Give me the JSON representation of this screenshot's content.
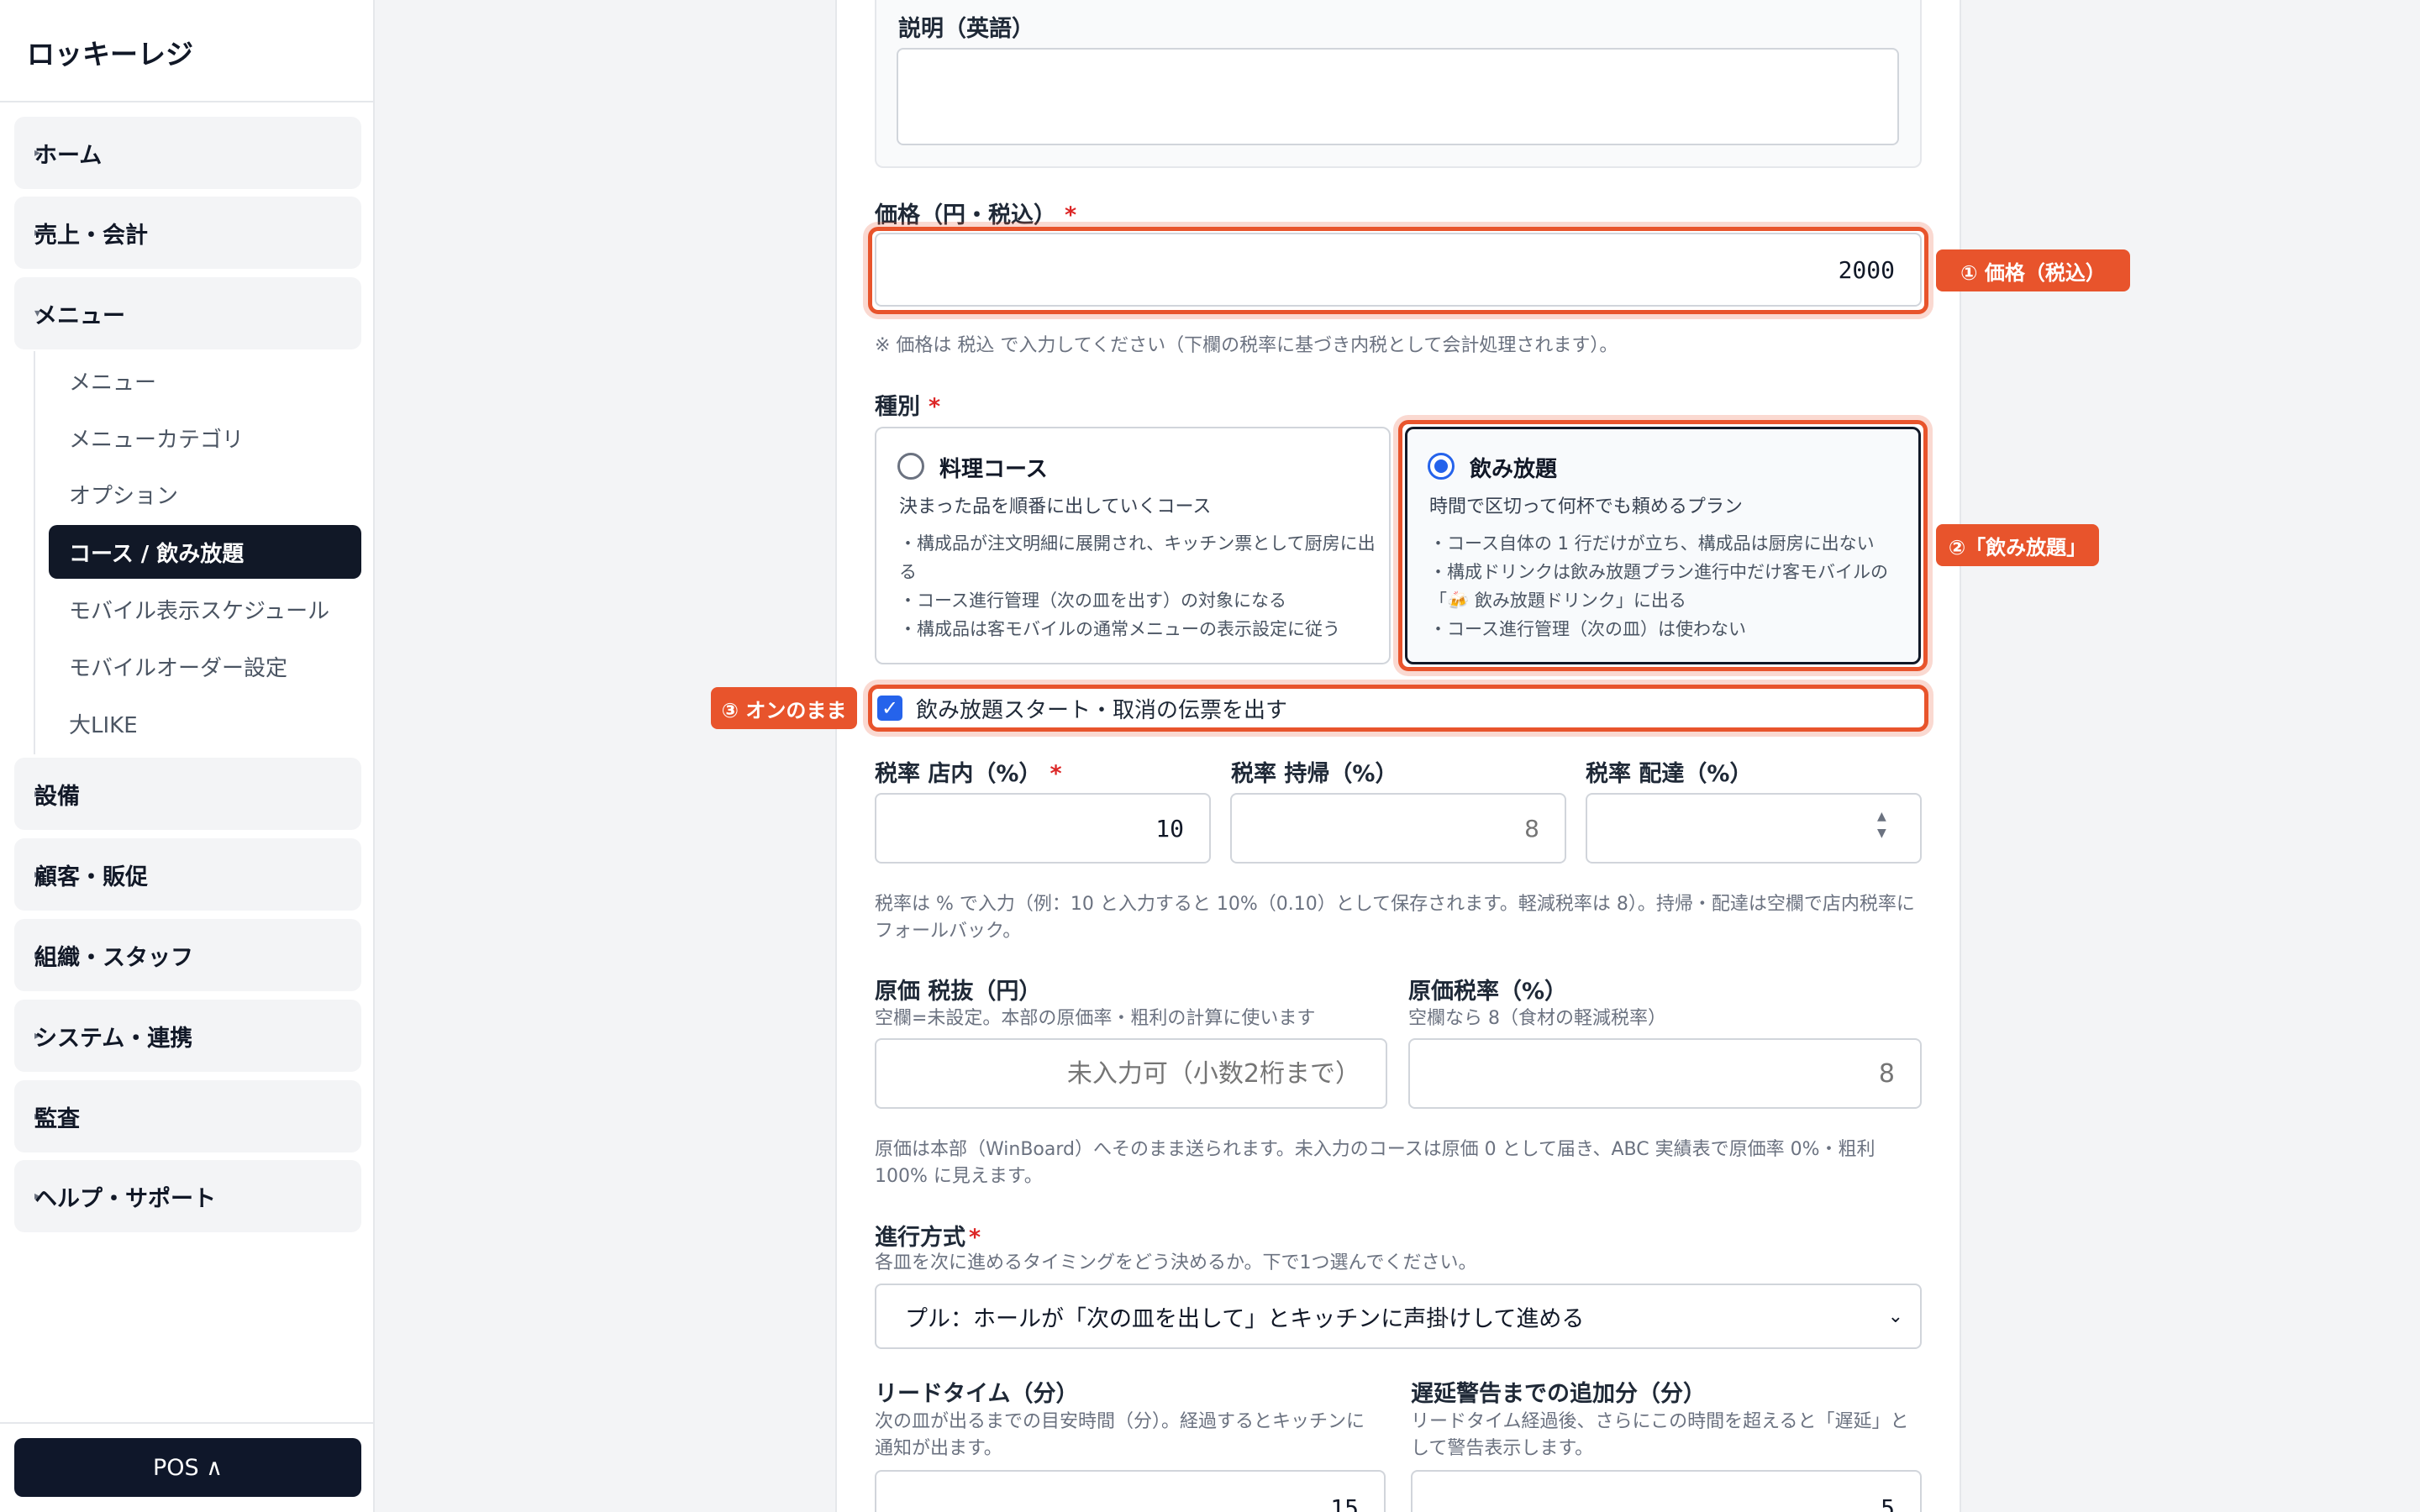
{
  "sidebar": {
    "brand": "ロッキーレジ",
    "groups": [
      {
        "label": "ホーム",
        "arrow": "▸"
      },
      {
        "label": "売上・会計",
        "arrow": "▸"
      },
      {
        "label": "メニュー",
        "arrow": "▾"
      },
      {
        "label": "設備",
        "arrow": "▸"
      },
      {
        "label": "顧客・販促",
        "arrow": "▸"
      },
      {
        "label": "組織・スタッフ",
        "arrow": "▸"
      },
      {
        "label": "システム・連携",
        "arrow": "▸"
      },
      {
        "label": "監査",
        "arrow": "▸"
      },
      {
        "label": "ヘルプ・サポート",
        "arrow": "▸"
      }
    ],
    "menu_items": [
      "メニュー",
      "メニューカテゴリ",
      "オプション",
      "コース / 飲み放題",
      "モバイル表示スケジュール",
      "モバイルオーダー設定",
      "大LIKE"
    ],
    "active_item": "コース / 飲み放題",
    "pos_button": "POS ∧"
  },
  "form": {
    "desc_en_label": "説明（英語）",
    "price_label": "価格（円・税込）",
    "required_mark": "*",
    "price_value": "2000",
    "price_note": "※ 価格は 税込 で入力してください（下欄の税率に基づき内税として会計処理されます）。",
    "type_label": "種別",
    "type_cooking": {
      "title": "料理コース",
      "desc": "決まった品を順番に出していくコース",
      "bullets": [
        "・構成品が注文明細に展開され、キッチン票として厨房に出る",
        "・コース進行管理（次の皿を出す）の対象になる",
        "・構成品は客モバイルの通常メニューの表示設定に従う"
      ]
    },
    "type_drink": {
      "title": "飲み放題",
      "desc": "時間で区切って何杯でも頼めるプラン",
      "bullets": [
        "・コース自体の 1 行だけが立ち、構成品は厨房に出ない",
        "・構成ドリンクは飲み放題プラン進行中だけ客モバイルの「🍻 飲み放題ドリンク」に出る",
        "・コース進行管理（次の皿）は使わない"
      ]
    },
    "slip_checkbox_label": "飲み放題スタート・取消の伝票を出す",
    "tax_in_label": "税率 店内（%）",
    "tax_in_value": "10",
    "tax_takeout_label": "税率 持帰（%）",
    "tax_takeout_placeholder": "8",
    "tax_delivery_label": "税率 配達（%）",
    "tax_help": "税率は % で入力（例：10 と入力すると 10%（0.10）として保存されます。軽減税率は 8）。持帰・配達は空欄で店内税率にフォールバック。",
    "cost_label": "原価 税抜（円）",
    "cost_help": "空欄=未設定。本部の原価率・粗利の計算に使います",
    "cost_placeholder": "未入力可（小数2桁まで）",
    "cost_tax_label": "原価税率（%）",
    "cost_tax_help": "空欄なら 8（食材の軽減税率）",
    "cost_tax_placeholder": "8",
    "cost_note": "原価は本部（WinBoard）へそのまま送られます。未入力のコースは原価 0 として届き、ABC 実績表で原価率 0%・粗利 100% に見えます。",
    "progress_label": "進行方式",
    "progress_help": "各皿を次に進めるタイミングをどう決めるか。下で1つ選んでください。",
    "progress_value": "プル：ホールが「次の皿を出して」とキッチンに声掛けして進める",
    "lead_label": "リードタイム（分）",
    "lead_help": "次の皿が出るまでの目安時間（分）。経過するとキッチンに通知が出ます。",
    "lead_value": "15",
    "delay_label": "遅延警告までの追加分（分）",
    "delay_help": "リードタイム経過後、さらにこの時間を超えると「遅延」として警告表示します。",
    "delay_value": "5"
  },
  "annotations": {
    "a1": "① 価格（税込）",
    "a2": "②「飲み放題」",
    "a3": "③ オンのまま"
  },
  "colors": {
    "accent": "#e8542c",
    "radio_selected": "#2563eb",
    "active_nav": "#111827"
  }
}
